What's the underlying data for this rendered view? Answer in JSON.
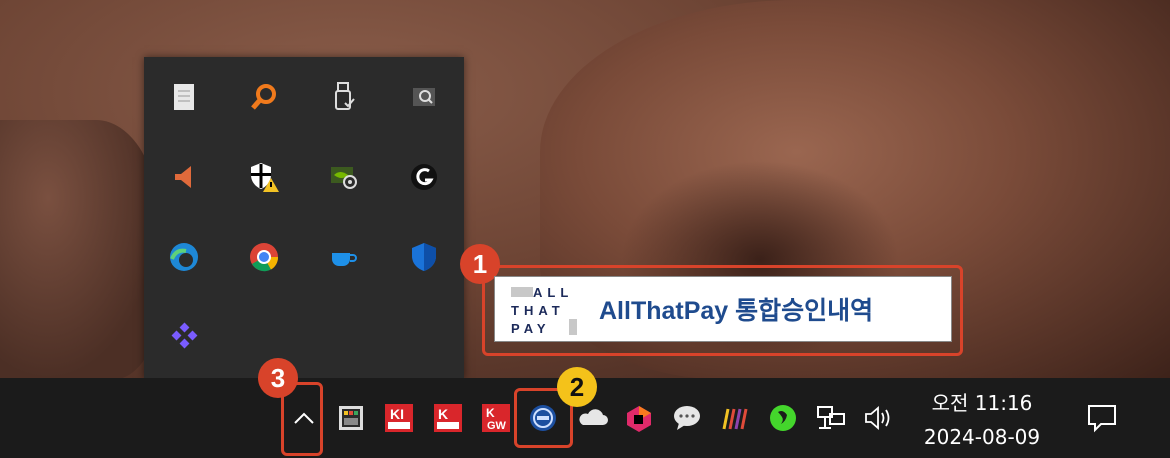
{
  "tray_popup": {
    "icons": [
      {
        "name": "notepad-icon"
      },
      {
        "name": "search-app-icon"
      },
      {
        "name": "usb-device-icon"
      },
      {
        "name": "screen-capture-icon"
      },
      {
        "name": "speaker-app-icon"
      },
      {
        "name": "security-warning-icon"
      },
      {
        "name": "nvidia-icon"
      },
      {
        "name": "logitech-g-icon"
      },
      {
        "name": "edge-icon"
      },
      {
        "name": "chrome-icon"
      },
      {
        "name": "cup-icon"
      },
      {
        "name": "defender-icon"
      },
      {
        "name": "diamond-grid-icon"
      }
    ]
  },
  "tooltip": {
    "logo_line1": "ALL",
    "logo_line2": "THAT",
    "logo_line3": "PAY",
    "text": "AllThatPay 통합승인내역"
  },
  "badges": {
    "one": "1",
    "two": "2",
    "three": "3"
  },
  "clock": {
    "time": "오전 11:16",
    "date": "2024-08-09"
  },
  "colors": {
    "accent": "#d8432a",
    "badge2": "#f4c21a",
    "tooltip_text": "#1f4b8e"
  }
}
